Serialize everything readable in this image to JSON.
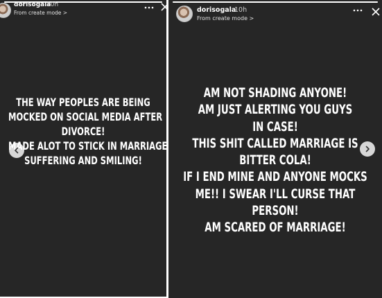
{
  "stories": [
    {
      "username": "dorisogala",
      "time": "10h",
      "subline": "From create mode >",
      "progress": 1.0,
      "text_lines": [
        "THE WAY PEOPLES ARE BEING",
        "MOCKED ON SOCIAL MEDIA AFTER",
        "DIVORCE!",
        "MADE ALOT TO STICK IN MARRIAGE",
        "SUFFERING AND SMILING!"
      ]
    },
    {
      "username": "dorisogala",
      "time": "10h",
      "subline": "From create mode >",
      "progress": 1.0,
      "text_lines": [
        "AM NOT SHADING ANYONE!",
        "AM JUST ALERTING YOU GUYS",
        "IN CASE!",
        "THIS SHIT CALLED MARRIAGE IS",
        "BITTER COLA!",
        "IF I END MINE AND ANYONE MOCKS",
        "ME!! I SWEAR I'LL CURSE THAT",
        "PERSON!",
        "AM SCARED OF MARRIAGE!"
      ]
    }
  ],
  "icons": {
    "more": "more-horizontal-icon",
    "close": "close-icon",
    "prev": "chevron-left-icon",
    "next": "chevron-right-icon"
  },
  "colors": {
    "story_background": "#262626",
    "text": "#ffffff",
    "page_background": "#ffffff"
  }
}
